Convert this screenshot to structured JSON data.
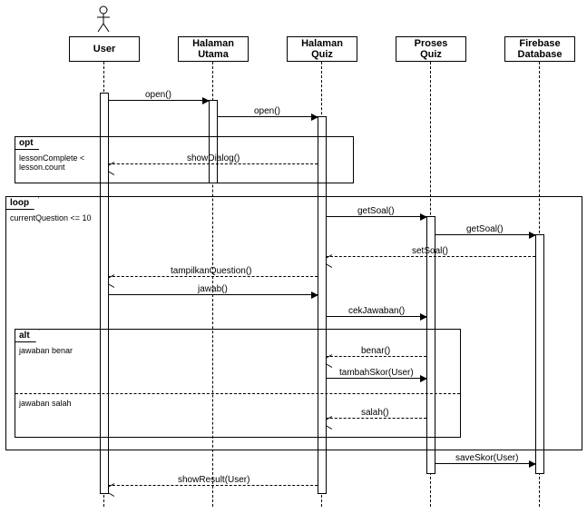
{
  "actors": {
    "user": "User",
    "halaman_utama": "Halaman\nUtama",
    "halaman_quiz": "Halaman\nQuiz",
    "proses_quiz": "Proses\nQuiz",
    "firebase": "Firebase\nDatabase"
  },
  "messages": {
    "open1": "open()",
    "open2": "open()",
    "showDialog": "showDialog()",
    "getSoal1": "getSoal()",
    "getSoal2": "getSoal()",
    "setSoal": "setSoal()",
    "tampilkanQuestion": "tampilkanQuestion()",
    "jawab": "jawab()",
    "cekJawaban": "cekJawaban()",
    "benar": "benar()",
    "tambahSkor": "tambahSkor(User)",
    "salah": "salah()",
    "saveSkor": "saveSkor(User)",
    "showResult": "showResult(User)"
  },
  "fragments": {
    "opt": {
      "tag": "opt",
      "guard": "lessonComplete <\nlesson.count"
    },
    "loop": {
      "tag": "loop",
      "guard": "currentQuestion <= 10"
    },
    "alt": {
      "tag": "alt",
      "guard_true": "jawaban benar",
      "guard_false": "jawaban salah"
    }
  },
  "chart_data": {
    "type": "sequence-diagram",
    "participants": [
      {
        "id": "user",
        "name": "User",
        "kind": "actor"
      },
      {
        "id": "halaman_utama",
        "name": "Halaman Utama",
        "kind": "object"
      },
      {
        "id": "halaman_quiz",
        "name": "Halaman Quiz",
        "kind": "object"
      },
      {
        "id": "proses_quiz",
        "name": "Proses Quiz",
        "kind": "object"
      },
      {
        "id": "firebase",
        "name": "Firebase Database",
        "kind": "object"
      }
    ],
    "interactions": [
      {
        "from": "user",
        "to": "halaman_utama",
        "label": "open()",
        "type": "sync"
      },
      {
        "from": "halaman_utama",
        "to": "halaman_quiz",
        "label": "open()",
        "type": "sync"
      },
      {
        "fragment": "opt",
        "guard": "lessonComplete < lesson.count",
        "body": [
          {
            "from": "halaman_quiz",
            "to": "user",
            "label": "showDialog()",
            "type": "return"
          }
        ]
      },
      {
        "fragment": "loop",
        "guard": "currentQuestion <= 10",
        "body": [
          {
            "from": "halaman_quiz",
            "to": "proses_quiz",
            "label": "getSoal()",
            "type": "sync"
          },
          {
            "from": "proses_quiz",
            "to": "firebase",
            "label": "getSoal()",
            "type": "sync"
          },
          {
            "from": "firebase",
            "to": "halaman_quiz",
            "label": "setSoal()",
            "type": "return"
          },
          {
            "from": "halaman_quiz",
            "to": "user",
            "label": "tampilkanQuestion()",
            "type": "return"
          },
          {
            "from": "user",
            "to": "halaman_quiz",
            "label": "jawab()",
            "type": "sync"
          },
          {
            "from": "halaman_quiz",
            "to": "proses_quiz",
            "label": "cekJawaban()",
            "type": "sync"
          },
          {
            "fragment": "alt",
            "branches": [
              {
                "guard": "jawaban benar",
                "body": [
                  {
                    "from": "proses_quiz",
                    "to": "halaman_quiz",
                    "label": "benar()",
                    "type": "return"
                  },
                  {
                    "from": "halaman_quiz",
                    "to": "proses_quiz",
                    "label": "tambahSkor(User)",
                    "type": "sync"
                  }
                ]
              },
              {
                "guard": "jawaban salah",
                "body": [
                  {
                    "from": "proses_quiz",
                    "to": "halaman_quiz",
                    "label": "salah()",
                    "type": "return"
                  }
                ]
              }
            ]
          }
        ]
      },
      {
        "from": "proses_quiz",
        "to": "firebase",
        "label": "saveSkor(User)",
        "type": "sync"
      },
      {
        "from": "halaman_quiz",
        "to": "user",
        "label": "showResult(User)",
        "type": "return"
      }
    ]
  }
}
